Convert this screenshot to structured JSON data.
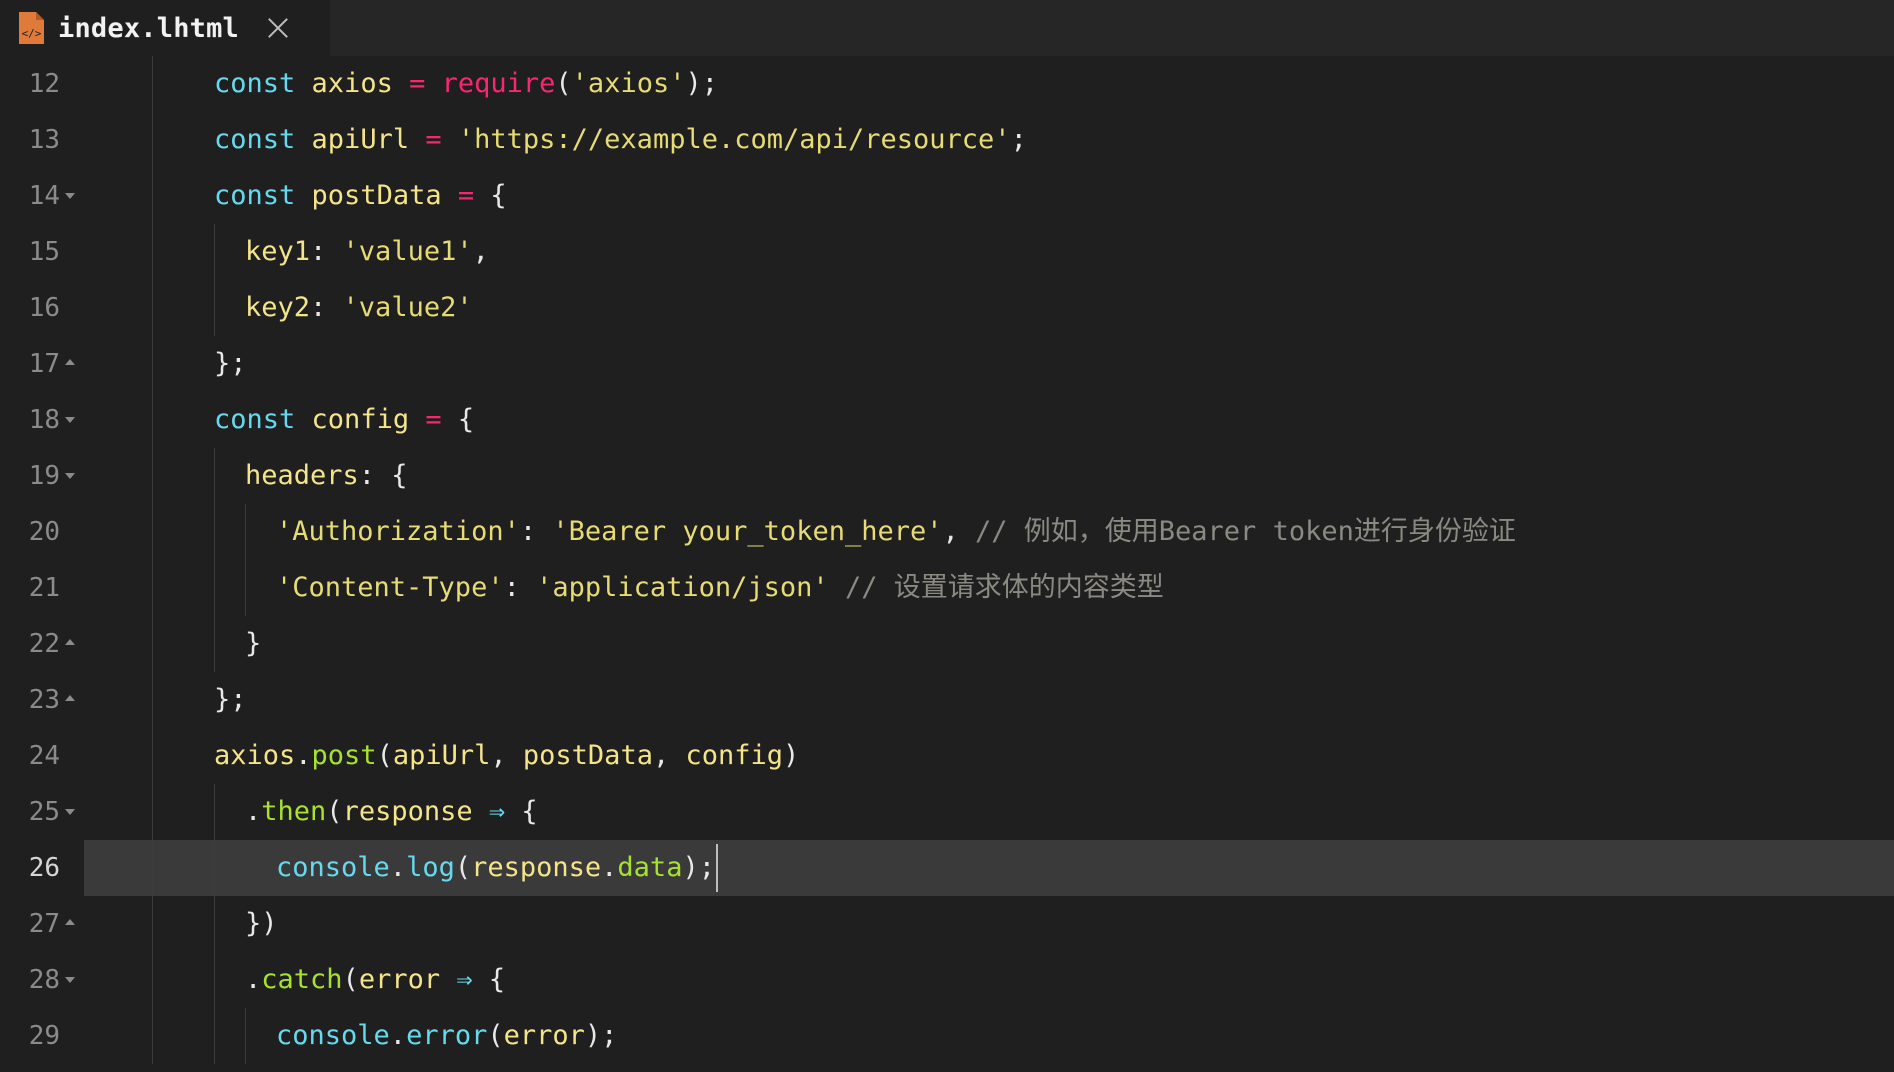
{
  "tab": {
    "title": "index.lhtml",
    "icon": "html-file-icon",
    "close_icon": "close-icon"
  },
  "lines": [
    {
      "num": "12",
      "fold": "",
      "indent": 0,
      "tokens": [
        {
          "t": "const",
          "c": "kw"
        },
        {
          "t": " ",
          "c": "pl"
        },
        {
          "t": "axios",
          "c": "var"
        },
        {
          "t": " = ",
          "c": "op"
        },
        {
          "t": "require",
          "c": "fn"
        },
        {
          "t": "(",
          "c": "pl"
        },
        {
          "t": "'axios'",
          "c": "str"
        },
        {
          "t": ");",
          "c": "pl"
        }
      ]
    },
    {
      "num": "13",
      "fold": "",
      "indent": 0,
      "tokens": [
        {
          "t": "const",
          "c": "kw"
        },
        {
          "t": " ",
          "c": "pl"
        },
        {
          "t": "apiUrl",
          "c": "var"
        },
        {
          "t": " = ",
          "c": "op"
        },
        {
          "t": "'https://example.com/api/resource'",
          "c": "str"
        },
        {
          "t": ";",
          "c": "pl"
        }
      ]
    },
    {
      "num": "14",
      "fold": "down",
      "indent": 0,
      "tokens": [
        {
          "t": "const",
          "c": "kw"
        },
        {
          "t": " ",
          "c": "pl"
        },
        {
          "t": "postData",
          "c": "var"
        },
        {
          "t": " = ",
          "c": "op"
        },
        {
          "t": "{",
          "c": "pl"
        }
      ]
    },
    {
      "num": "15",
      "fold": "",
      "indent": 1,
      "tokens": [
        {
          "t": "key1",
          "c": "var"
        },
        {
          "t": ": ",
          "c": "pl"
        },
        {
          "t": "'value1'",
          "c": "str"
        },
        {
          "t": ",",
          "c": "pl"
        }
      ]
    },
    {
      "num": "16",
      "fold": "",
      "indent": 1,
      "tokens": [
        {
          "t": "key2",
          "c": "var"
        },
        {
          "t": ": ",
          "c": "pl"
        },
        {
          "t": "'value2'",
          "c": "str"
        }
      ]
    },
    {
      "num": "17",
      "fold": "up",
      "indent": 0,
      "tokens": [
        {
          "t": "};",
          "c": "pl"
        }
      ]
    },
    {
      "num": "18",
      "fold": "down",
      "indent": 0,
      "tokens": [
        {
          "t": "const",
          "c": "kw"
        },
        {
          "t": " ",
          "c": "pl"
        },
        {
          "t": "config",
          "c": "var"
        },
        {
          "t": " = ",
          "c": "op"
        },
        {
          "t": "{",
          "c": "pl"
        }
      ]
    },
    {
      "num": "19",
      "fold": "down",
      "indent": 1,
      "tokens": [
        {
          "t": "headers",
          "c": "var"
        },
        {
          "t": ": {",
          "c": "pl"
        }
      ]
    },
    {
      "num": "20",
      "fold": "",
      "indent": 2,
      "tokens": [
        {
          "t": "'Authorization'",
          "c": "str"
        },
        {
          "t": ": ",
          "c": "pl"
        },
        {
          "t": "'Bearer your_token_here'",
          "c": "str"
        },
        {
          "t": ", ",
          "c": "pl"
        },
        {
          "t": "// 例如，使用Bearer token进行身份验证",
          "c": "cm"
        }
      ]
    },
    {
      "num": "21",
      "fold": "",
      "indent": 2,
      "tokens": [
        {
          "t": "'Content-Type'",
          "c": "str"
        },
        {
          "t": ": ",
          "c": "pl"
        },
        {
          "t": "'application/json'",
          "c": "str"
        },
        {
          "t": " ",
          "c": "pl"
        },
        {
          "t": "// 设置请求体的内容类型",
          "c": "cm"
        }
      ]
    },
    {
      "num": "22",
      "fold": "up",
      "indent": 1,
      "tokens": [
        {
          "t": "}",
          "c": "pl"
        }
      ]
    },
    {
      "num": "23",
      "fold": "up",
      "indent": 0,
      "tokens": [
        {
          "t": "};",
          "c": "pl"
        }
      ]
    },
    {
      "num": "24",
      "fold": "",
      "indent": 0,
      "tokens": [
        {
          "t": "axios",
          "c": "var"
        },
        {
          "t": ".",
          "c": "pl"
        },
        {
          "t": "post",
          "c": "mth"
        },
        {
          "t": "(",
          "c": "pl"
        },
        {
          "t": "apiUrl",
          "c": "var"
        },
        {
          "t": ", ",
          "c": "pl"
        },
        {
          "t": "postData",
          "c": "var"
        },
        {
          "t": ", ",
          "c": "pl"
        },
        {
          "t": "config",
          "c": "var"
        },
        {
          "t": ")",
          "c": "pl"
        }
      ]
    },
    {
      "num": "25",
      "fold": "down",
      "indent": 1,
      "tokens": [
        {
          "t": ".",
          "c": "pl"
        },
        {
          "t": "then",
          "c": "mth"
        },
        {
          "t": "(",
          "c": "pl"
        },
        {
          "t": "response",
          "c": "var"
        },
        {
          "t": " ⇒ ",
          "c": "arrow"
        },
        {
          "t": "{",
          "c": "pl"
        }
      ]
    },
    {
      "num": "26",
      "fold": "",
      "indent": 2,
      "active": true,
      "tokens": [
        {
          "t": "console",
          "c": "obj"
        },
        {
          "t": ".",
          "c": "pl"
        },
        {
          "t": "log",
          "c": "obj"
        },
        {
          "t": "(",
          "c": "pl"
        },
        {
          "t": "response",
          "c": "var"
        },
        {
          "t": ".",
          "c": "pl"
        },
        {
          "t": "data",
          "c": "mth"
        },
        {
          "t": ");",
          "c": "pl"
        }
      ]
    },
    {
      "num": "27",
      "fold": "up",
      "indent": 1,
      "tokens": [
        {
          "t": "})",
          "c": "pl"
        }
      ]
    },
    {
      "num": "28",
      "fold": "down",
      "indent": 1,
      "tokens": [
        {
          "t": ".",
          "c": "pl"
        },
        {
          "t": "catch",
          "c": "mth"
        },
        {
          "t": "(",
          "c": "pl"
        },
        {
          "t": "error",
          "c": "var"
        },
        {
          "t": " ⇒ ",
          "c": "arrow"
        },
        {
          "t": "{",
          "c": "pl"
        }
      ]
    },
    {
      "num": "29",
      "fold": "",
      "indent": 2,
      "tokens": [
        {
          "t": "console",
          "c": "obj"
        },
        {
          "t": ".",
          "c": "pl"
        },
        {
          "t": "error",
          "c": "obj"
        },
        {
          "t": "(",
          "c": "pl"
        },
        {
          "t": "error",
          "c": "var"
        },
        {
          "t": ");",
          "c": "pl"
        }
      ]
    }
  ]
}
